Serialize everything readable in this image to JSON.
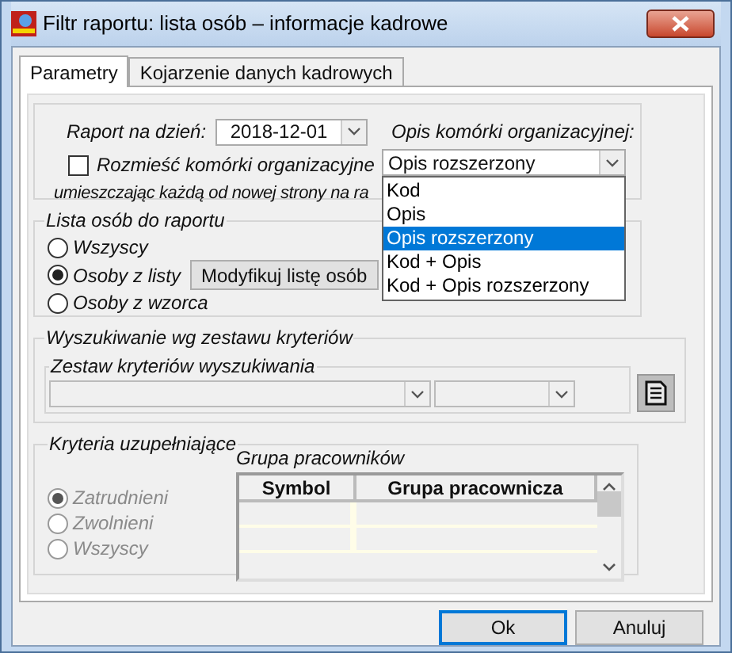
{
  "window": {
    "title": "Filtr raportu: lista osób – informacje kadrowe"
  },
  "tabs": [
    {
      "label": "Parametry",
      "selected": true
    },
    {
      "label": "Kojarzenie danych kadrowych",
      "selected": false
    }
  ],
  "report_date": {
    "label": "Raport na dzień:",
    "value": "2018-12-01"
  },
  "distribute_checkbox": {
    "label": "Rozmieść komórki organizacyjne",
    "label_line_2": "umieszczając każdą od nowej strony na ra",
    "checked": false
  },
  "org_unit_description": {
    "label": "Opis komórki organizacyjnej:",
    "value": "Opis rozszerzony",
    "options": [
      {
        "label": "Kod",
        "selected": false
      },
      {
        "label": "Opis",
        "selected": false
      },
      {
        "label": "Opis rozszerzony",
        "selected": true
      },
      {
        "label": "Kod + Opis",
        "selected": false
      },
      {
        "label": "Kod + Opis rozszerzony",
        "selected": false
      }
    ]
  },
  "person_list": {
    "title": "Lista osób do raportu",
    "options": [
      {
        "label": "Wszyscy",
        "selected": false
      },
      {
        "label": "Osoby z listy",
        "selected": true
      },
      {
        "label": "Osoby z wzorca",
        "selected": false
      }
    ],
    "modify_button": "Modyfikuj listę osób"
  },
  "criteria_search": {
    "title": "Wyszukiwanie wg zestawu kryteriów",
    "set_title": "Zestaw kryteriów wyszukiwania"
  },
  "supplementary": {
    "title": "Kryteria uzupełniające",
    "options": [
      {
        "label": "Zatrudnieni",
        "selected": true,
        "disabled": true
      },
      {
        "label": "Zwolnieni",
        "selected": false,
        "disabled": true
      },
      {
        "label": "Wszyscy",
        "selected": false,
        "disabled": true
      }
    ],
    "table": {
      "title": "Grupa pracowników",
      "columns": [
        "Symbol",
        "Grupa pracownicza"
      ]
    }
  },
  "buttons": [
    {
      "label": "Ok",
      "default": true
    },
    {
      "label": "Anuluj",
      "default": false
    }
  ]
}
